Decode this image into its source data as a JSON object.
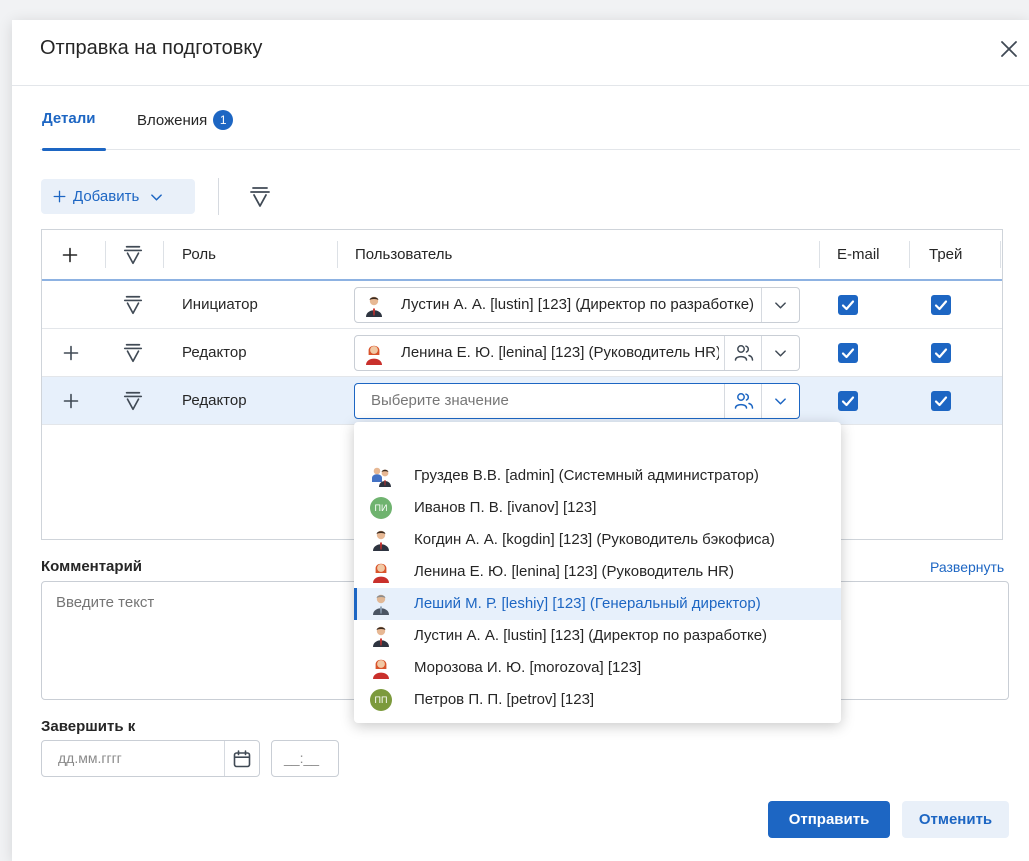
{
  "dialog": {
    "title": "Отправка на подготовку"
  },
  "tabs": [
    {
      "label": "Детали",
      "active": true
    },
    {
      "label": "Вложения",
      "count": "1",
      "active": false
    }
  ],
  "toolbar": {
    "add_label": "Добавить"
  },
  "grid": {
    "headers": {
      "role": "Роль",
      "user": "Пользователь",
      "email": "E-mail",
      "tray": "Трей"
    },
    "rows": [
      {
        "role": "Инициатор",
        "user": "Лустин А. А. [lustin] [123] (Директор по разработке)",
        "avatar": "man-dark-suit",
        "email": true,
        "tray": true
      },
      {
        "role": "Редактор",
        "user": "Ленина Е. Ю. [lenina] [123] (Руководитель HR)",
        "avatar": "woman-red-hair",
        "email": true,
        "tray": true
      },
      {
        "role": "Редактор",
        "user": "",
        "placeholder": "Выберите значение",
        "email": true,
        "tray": true
      }
    ]
  },
  "dropdown": {
    "options": [
      {
        "text": "Груздев В.В. [admin] (Системный администратор)",
        "avatar": "admin-user"
      },
      {
        "text": "Иванов П. В. [ivanov] [123]",
        "avatar": "initials",
        "initials": "ПИ",
        "color": "#6fb36f"
      },
      {
        "text": "Когдин А. А. [kogdin] [123] (Руководитель бэкофиса)",
        "avatar": "man-dark-suit"
      },
      {
        "text": "Ленина Е. Ю. [lenina] [123] (Руководитель HR)",
        "avatar": "woman-red-hair"
      },
      {
        "text": "Леший М. Р. [leshiy] [123] (Генеральный директор)",
        "avatar": "man-grey",
        "highlighted": true
      },
      {
        "text": "Лустин А. А. [lustin] [123] (Директор по разработке)",
        "avatar": "man-dark-suit"
      },
      {
        "text": "Морозова И. Ю. [morozova] [123]",
        "avatar": "woman-red-hair"
      },
      {
        "text": "Петров П. П. [petrov] [123]",
        "avatar": "initials",
        "initials": "ПП",
        "color": "#7c9a3c"
      }
    ]
  },
  "comment": {
    "label": "Комментарий",
    "expand_link": "Развернуть",
    "placeholder": "Введите текст"
  },
  "deadline": {
    "label": "Завершить к",
    "date_placeholder": "дд.мм.гггг",
    "time_placeholder": "__:__"
  },
  "actions": {
    "submit": "Отправить",
    "cancel": "Отменить"
  },
  "colors": {
    "accent": "#1d66c3",
    "accent_light": "#e9f0f9",
    "selected_row": "#e7f0fb"
  }
}
